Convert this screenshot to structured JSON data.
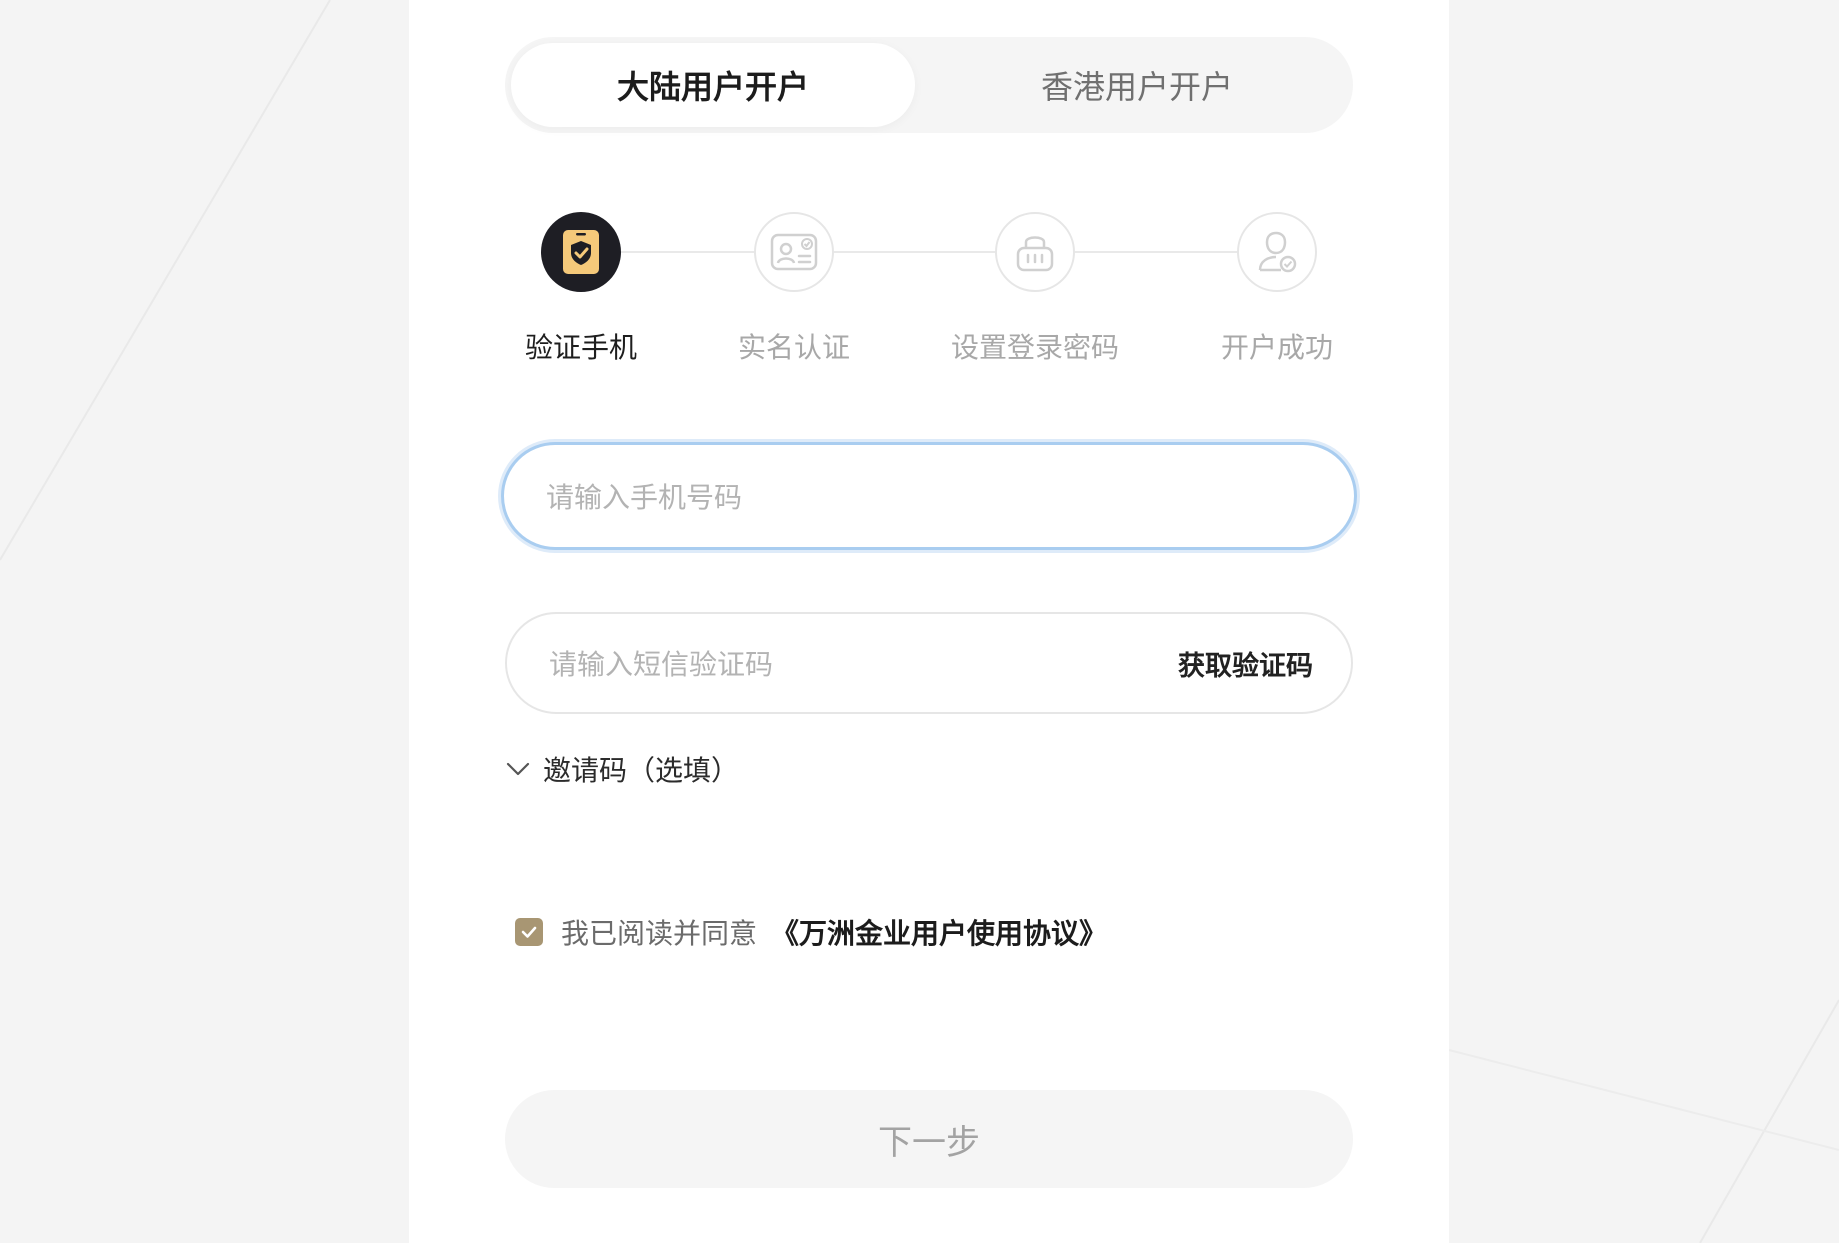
{
  "tabs": {
    "mainland": "大陆用户开户",
    "hongkong": "香港用户开户"
  },
  "steps": [
    {
      "label": "验证手机",
      "icon": "shield-phone-icon",
      "state": "active"
    },
    {
      "label": "实名认证",
      "icon": "id-card-icon",
      "state": "todo"
    },
    {
      "label": "设置登录密码",
      "icon": "lock-icon",
      "state": "todo"
    },
    {
      "label": "开户成功",
      "icon": "user-check-icon",
      "state": "todo"
    }
  ],
  "form": {
    "phone_placeholder": "请输入手机号码",
    "sms_placeholder": "请输入短信验证码",
    "get_code_label": "获取验证码",
    "invite_label": "邀请码（选填）"
  },
  "agreement": {
    "prefix": "我已阅读并同意",
    "link": "《万洲金业用户使用协议》",
    "checked": true
  },
  "next_button": "下一步",
  "colors": {
    "accent_gold": "#a89673",
    "active_step_bg": "#1e1e24",
    "active_step_icon": "#f5c97a",
    "focus_border": "#a9cdf0"
  }
}
